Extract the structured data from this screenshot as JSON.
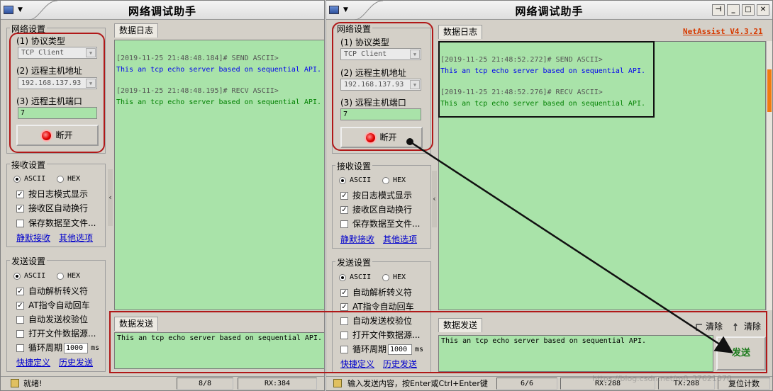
{
  "left_window": {
    "title": "网络调试助手",
    "net_settings": {
      "group_label": "网络设置",
      "protocol_label": "(1) 协议类型",
      "protocol_value": "TCP Client",
      "remote_host_label": "(2) 远程主机地址",
      "remote_host_value": "192.168.137.93",
      "remote_port_label": "(3) 远程主机端口",
      "remote_port_value": "7",
      "disconnect_label": "断开"
    },
    "recv_settings": {
      "group_label": "接收设置",
      "radio_ascii": "ASCII",
      "radio_hex": "HEX",
      "opt_log_mode": "按日志模式显示",
      "opt_auto_wrap": "接收区自动换行",
      "opt_save_file": "保存数据至文件...",
      "link_silent": "静默接收",
      "link_other": "其他选项"
    },
    "send_settings": {
      "group_label": "发送设置",
      "radio_ascii": "ASCII",
      "radio_hex": "HEX",
      "opt_escape": "自动解析转义符",
      "opt_at": "AT指令自动回车",
      "opt_checksum": "自动发送校验位",
      "opt_open_file": "打开文件数据源...",
      "opt_loop": "循环周期",
      "loop_value": "1000",
      "loop_unit": "ms",
      "link_shortcut": "快捷定义",
      "link_history": "历史发送"
    },
    "log_tab": "数据日志",
    "log": [
      {
        "header": "[2019-11-25 21:48:48.184]# SEND ASCII>",
        "body": "This an tcp echo server based on sequential API.",
        "dir": "send"
      },
      {
        "header": "[2019-11-25 21:48:48.195]# RECV ASCII>",
        "body": "This an tcp echo server based on sequential API.",
        "dir": "recv"
      }
    ],
    "send_tab": "数据发送",
    "send_text": "This an tcp echo server based on sequential API.",
    "status_ready": "就绪!",
    "status_count": "8/8",
    "status_rx": "RX:384"
  },
  "right_window": {
    "title": "网络调试助手",
    "brand": "NetAssist V4.3.21",
    "net_settings": {
      "group_label": "网络设置",
      "protocol_label": "(1) 协议类型",
      "protocol_value": "TCP Client",
      "remote_host_label": "(2) 远程主机地址",
      "remote_host_value": "192.168.137.93",
      "remote_port_label": "(3) 远程主机端口",
      "remote_port_value": "7",
      "disconnect_label": "断开"
    },
    "recv_settings": {
      "group_label": "接收设置",
      "radio_ascii": "ASCII",
      "radio_hex": "HEX",
      "opt_log_mode": "按日志模式显示",
      "opt_auto_wrap": "接收区自动换行",
      "opt_save_file": "保存数据至文件...",
      "link_silent": "静默接收",
      "link_other": "其他选项"
    },
    "send_settings": {
      "group_label": "发送设置",
      "radio_ascii": "ASCII",
      "radio_hex": "HEX",
      "opt_escape": "自动解析转义符",
      "opt_at": "AT指令自动回车",
      "opt_checksum": "自动发送校验位",
      "opt_open_file": "打开文件数据源...",
      "opt_loop": "循环周期",
      "loop_value": "1000",
      "loop_unit": "ms",
      "link_shortcut": "快捷定义",
      "link_history": "历史发送"
    },
    "log_tab": "数据日志",
    "log": [
      {
        "header": "[2019-11-25 21:48:52.272]# SEND ASCII>",
        "body": "This an tcp echo server based on sequential API.",
        "dir": "send"
      },
      {
        "header": "[2019-11-25 21:48:52.276]# RECV ASCII>",
        "body": "This an tcp echo server based on sequential API.",
        "dir": "recv"
      }
    ],
    "send_tab": "数据发送",
    "clear1": "清除",
    "clear2": "清除",
    "send_text": "This an tcp echo server based on sequential API.",
    "send_button": "发送",
    "status_hint": "输入发送内容，按Enter或Ctrl+Enter键",
    "status_count": "6/6",
    "status_rx": "RX:288",
    "status_tx": "TX:288",
    "status_reset": "复位计数"
  },
  "watermark": "https://blog.csdn.net/m0_37621078"
}
